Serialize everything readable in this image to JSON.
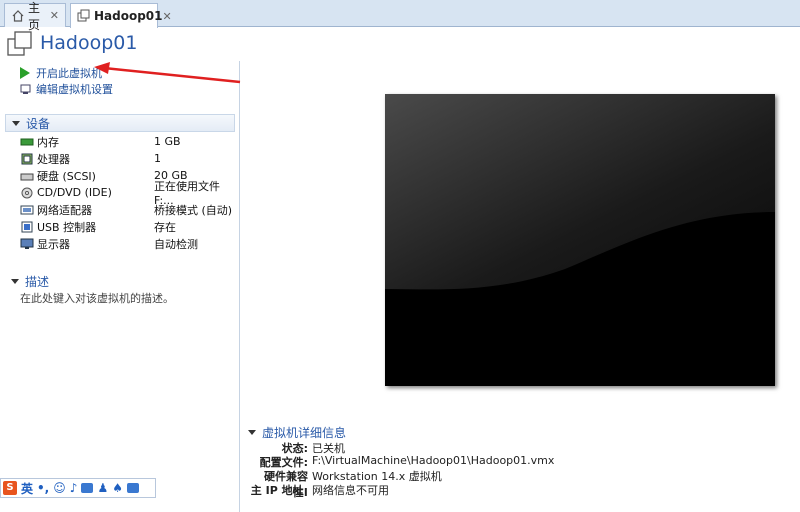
{
  "tabs": [
    {
      "label": "主页",
      "icon": "home-icon"
    },
    {
      "label": "Hadoop01",
      "icon": "vm-icon"
    }
  ],
  "vm_title": "Hadoop01",
  "actions": {
    "power_on": "开启此虚拟机",
    "edit_settings": "编辑虚拟机设置"
  },
  "devices_section": "设备",
  "devices": [
    {
      "name": "内存",
      "value": "1 GB",
      "icon": "memory-icon"
    },
    {
      "name": "处理器",
      "value": "1",
      "icon": "cpu-icon"
    },
    {
      "name": "硬盘 (SCSI)",
      "value": "20 GB",
      "icon": "harddisk-icon"
    },
    {
      "name": "CD/DVD (IDE)",
      "value": "正在使用文件 F:...",
      "icon": "cd-icon"
    },
    {
      "name": "网络适配器",
      "value": "桥接模式 (自动)",
      "icon": "network-icon"
    },
    {
      "name": "USB 控制器",
      "value": "存在",
      "icon": "usb-icon"
    },
    {
      "name": "显示器",
      "value": "自动检测",
      "icon": "monitor-icon"
    }
  ],
  "description_section": "描述",
  "description_hint": "在此处键入对该虚拟机的描述。",
  "details_section": "虚拟机详细信息",
  "details": [
    {
      "key": "状态:",
      "value": "已关机"
    },
    {
      "key": "配置文件:",
      "value": "F:\\VirtualMachine\\Hadoop01\\Hadoop01.vmx"
    },
    {
      "key": "硬件兼容性:",
      "value": "Workstation 14.x 虚拟机"
    },
    {
      "key": "主 IP 地址:",
      "value": "网络信息不可用"
    }
  ],
  "ime": {
    "lang": "英",
    "punct": "•,"
  }
}
